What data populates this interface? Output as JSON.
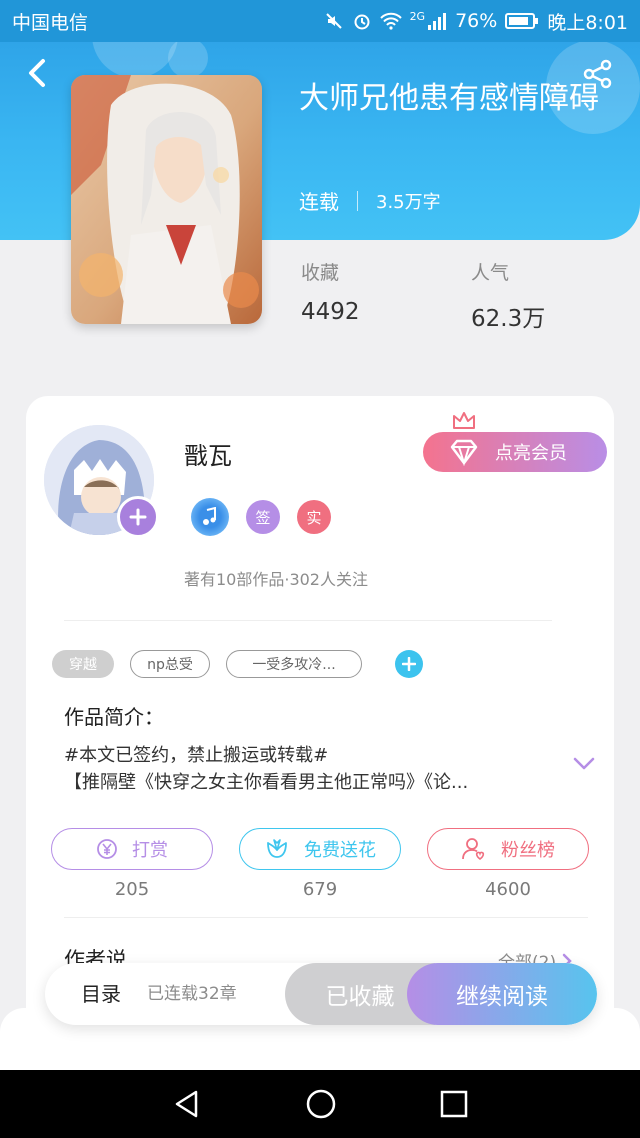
{
  "status_bar": {
    "carrier": "中国电信",
    "network": "2G",
    "battery": "76%",
    "time": "晚上8:01"
  },
  "book": {
    "title": "大师兄他患有感情障碍",
    "status": "连载",
    "word_count": "3.5万字",
    "favorites_label": "收藏",
    "favorites_value": "4492",
    "popularity_label": "人气",
    "popularity_value": "62.3万"
  },
  "author": {
    "name": "戬瓦",
    "vip_label": "点亮会员",
    "badges": [
      "签",
      "实"
    ],
    "summary": "著有10部作品·302人关注"
  },
  "tags": [
    "穿越",
    "np总受",
    "一受多攻冷..."
  ],
  "intro": {
    "title": "作品简介：",
    "line1": "#本文已签约，禁止搬运或转载#",
    "line2": "【推隔壁《快穿之女主你看看男主他正常吗》《论..."
  },
  "actions": [
    {
      "label": "打赏",
      "count": "205",
      "color": "#b58ee6"
    },
    {
      "label": "免费送花",
      "count": "679",
      "color": "#3fc6ee"
    },
    {
      "label": "粉丝榜",
      "count": "4600",
      "color": "#f06f80"
    }
  ],
  "author_says": {
    "title": "作者说",
    "all_label": "全部(2)"
  },
  "bottom_bar": {
    "toc_label": "目录",
    "chapters": "已连载32章",
    "collected_label": "已收藏",
    "read_label": "继续阅读"
  }
}
